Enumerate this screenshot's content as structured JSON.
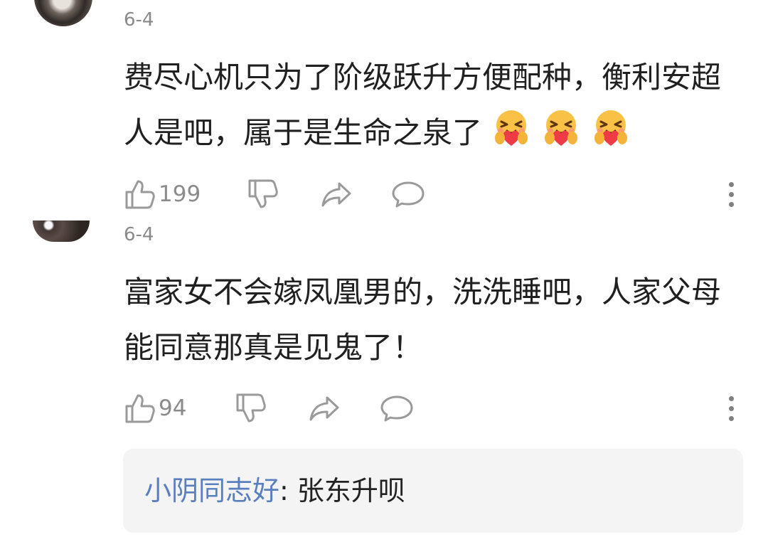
{
  "comments": [
    {
      "date": "6-4",
      "text": "费尽心机只为了阶级跃升方便配种，衡利安超人是吧，属于是生命之泉了",
      "emojis": [
        "hug-heart-emoji",
        "hug-heart-emoji",
        "hug-heart-emoji"
      ],
      "like_count": "199"
    },
    {
      "date": "6-4",
      "text": "富家女不会嫁凤凰男的，洗洗睡吧，人家父母能同意那真是见鬼了！",
      "like_count": "94",
      "reply": {
        "author": "小阴同志好",
        "separator": ":",
        "text": " 张东升呗"
      }
    }
  ],
  "colors": {
    "date": "#8a8a8a",
    "icon": "#9a9a9a",
    "reply_author": "#5a7fbf",
    "reply_background": "#f4f4f4"
  },
  "icons": {
    "like": "thumbs-up-icon",
    "dislike": "thumbs-down-icon",
    "share": "share-arrow-icon",
    "comment": "speech-bubble-icon",
    "more": "more-vertical-icon"
  }
}
